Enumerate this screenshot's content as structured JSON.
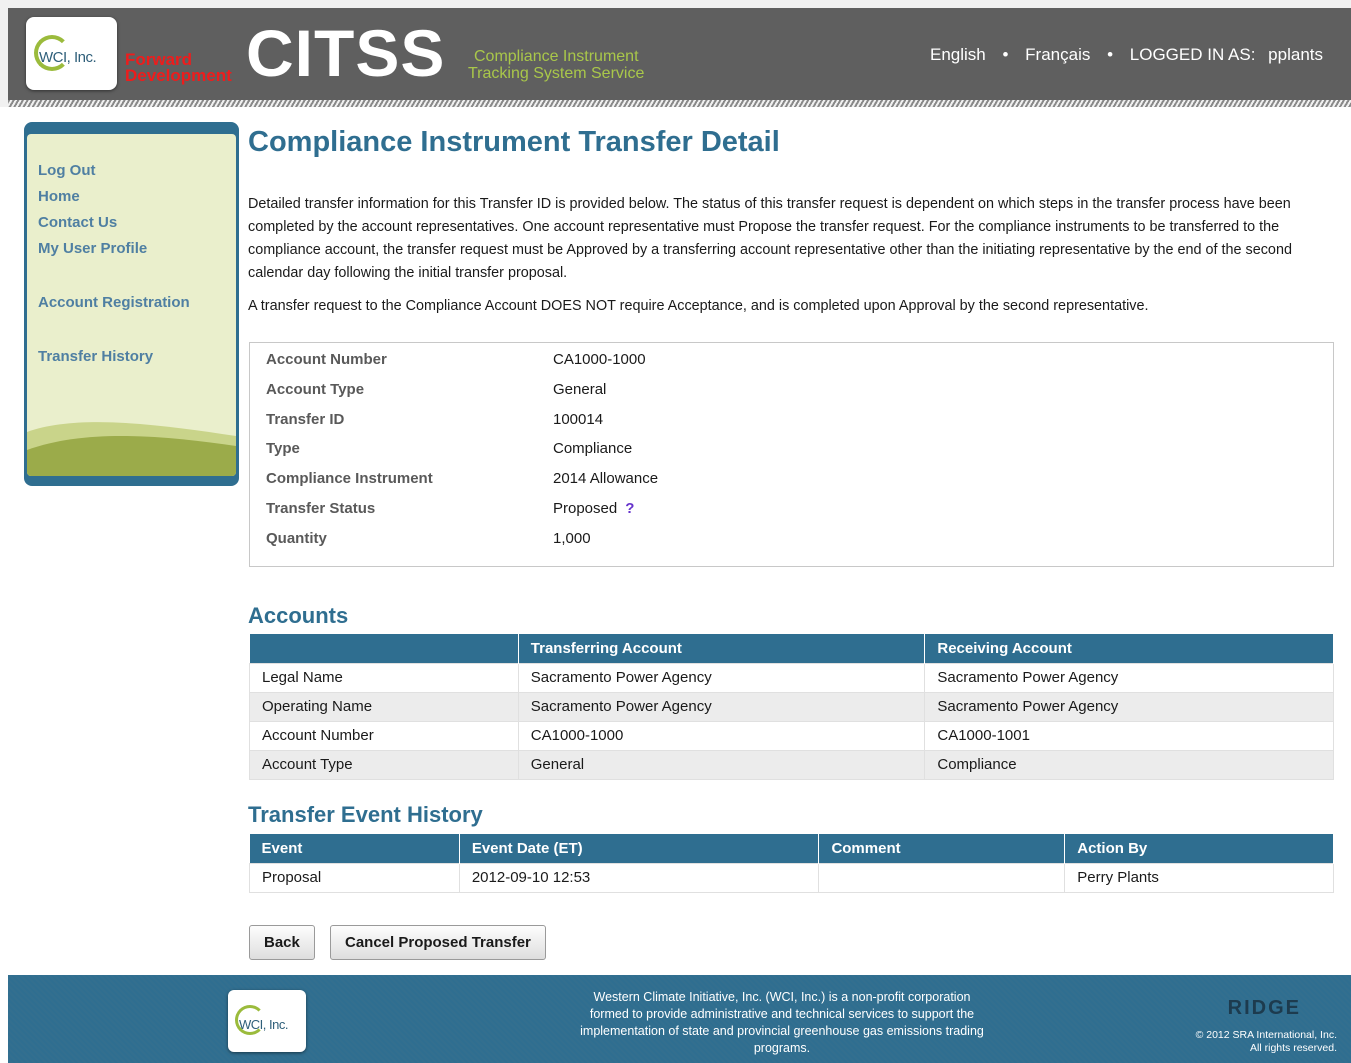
{
  "header": {
    "logo_text": "WCI, Inc.",
    "env_line1": "Forward",
    "env_line2": "Development",
    "app_name": "CITSS",
    "tagline_line1": "Compliance Instrument",
    "tagline_line2": "Tracking System Service",
    "lang_english": "English",
    "lang_french": "Français",
    "logged_in_label": "LOGGED IN AS:",
    "username": "pplants",
    "separator": "•"
  },
  "sidebar": {
    "items": [
      {
        "label": "Log Out"
      },
      {
        "label": "Home"
      },
      {
        "label": "Contact Us"
      },
      {
        "label": "My User Profile"
      },
      {
        "label": "Account Registration"
      },
      {
        "label": "Transfer History"
      }
    ]
  },
  "main": {
    "title": "Compliance Instrument Transfer Detail",
    "intro": "Detailed transfer information for this Transfer ID is provided below. The status of this transfer request is dependent on which steps in the transfer process have been completed by the account representatives. One account representative must Propose the transfer request. For the compliance instruments to be transferred to the compliance account, the transfer request must be Approved by a transferring account representative other than the initiating representative by the end of the second calendar day following the initial transfer proposal.",
    "intro2": "A transfer request to the Compliance Account DOES NOT require Acceptance, and is completed upon Approval by the second representative.",
    "details": [
      {
        "label": "Account Number",
        "value": "CA1000-1000"
      },
      {
        "label": "Account Type",
        "value": "General"
      },
      {
        "label": "Transfer ID",
        "value": "100014"
      },
      {
        "label": "Type",
        "value": "Compliance"
      },
      {
        "label": "Compliance Instrument",
        "value": "2014 Allowance"
      },
      {
        "label": "Transfer Status",
        "value": "Proposed"
      },
      {
        "label": "Quantity",
        "value": "1,000"
      }
    ],
    "help_glyph": "?"
  },
  "accounts": {
    "title": "Accounts",
    "headers": [
      "",
      "Transferring Account",
      "Receiving Account"
    ],
    "rows": [
      [
        "Legal Name",
        "Sacramento Power Agency",
        "Sacramento Power Agency"
      ],
      [
        "Operating Name",
        "Sacramento Power Agency",
        "Sacramento Power Agency"
      ],
      [
        "Account Number",
        "CA1000-1000",
        "CA1000-1001"
      ],
      [
        "Account Type",
        "General",
        "Compliance"
      ]
    ]
  },
  "history": {
    "title": "Transfer Event History",
    "headers": [
      "Event",
      "Event Date (ET)",
      "Comment",
      "Action By"
    ],
    "rows": [
      [
        "Proposal",
        "2012-09-10 12:53",
        "",
        "Perry Plants"
      ]
    ]
  },
  "buttons": {
    "back": "Back",
    "cancel": "Cancel Proposed Transfer"
  },
  "footer": {
    "logo_text": "WCI, Inc.",
    "text": "Western Climate Initiative, Inc. (WCI, Inc.) is a non-profit corporation formed to provide administrative and technical services to support the implementation of state and provincial greenhouse gas emissions trading programs.",
    "vendor_logo": "RIDGE",
    "copyright_line1": "© 2012 SRA International, Inc.",
    "copyright_line2": "All rights reserved."
  },
  "colors": {
    "brand_blue": "#2f6e90",
    "brand_green": "#9bbb3c",
    "env_red": "#ee1c1c",
    "help_purple": "#6633cc"
  }
}
